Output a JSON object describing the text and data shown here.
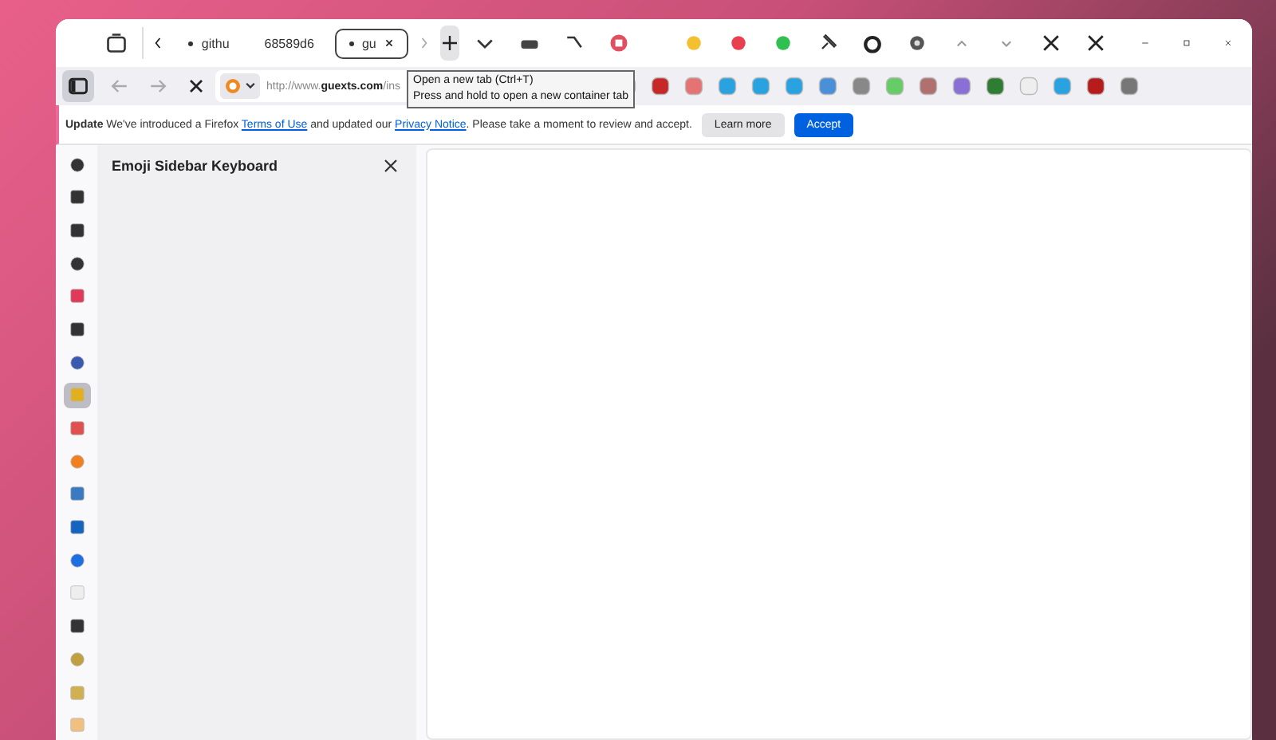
{
  "tabs": [
    {
      "label": "githu",
      "selected": false,
      "closable": false
    },
    {
      "label": "68589d6",
      "selected": false,
      "closable": false
    },
    {
      "label": "gu",
      "selected": true,
      "closable": true
    }
  ],
  "address_bar": {
    "url_host_prefix": "http://www.",
    "url_host": "guexts.com",
    "url_path": "/ins"
  },
  "tooltip": {
    "lines": [
      "Open a new tab (Ctrl+T)",
      "Press and hold to open a new container tab"
    ]
  },
  "notification": {
    "title": "Update",
    "text_before": "We've introduced a Firefox",
    "link_1": "Terms of Use",
    "text_middle": "and updated our",
    "link_2": "Privacy Notice",
    "text_after": ". Please take a moment to review and accept.",
    "buttons": [
      {
        "label": "Learn more",
        "kind": "secondary"
      },
      {
        "label": "Accept",
        "kind": "primary"
      }
    ]
  },
  "sidebar": {
    "title": "Emoji Sidebar Keyboard",
    "items": [
      {
        "selected": false
      },
      {
        "selected": false
      },
      {
        "selected": false
      },
      {
        "selected": false
      },
      {
        "selected": false
      },
      {
        "selected": false
      },
      {
        "selected": false
      },
      {
        "selected": true
      },
      {
        "selected": false
      },
      {
        "selected": false
      },
      {
        "selected": false
      },
      {
        "selected": false
      },
      {
        "selected": false
      },
      {
        "selected": false
      },
      {
        "selected": false
      },
      {
        "selected": false
      },
      {
        "selected": false
      },
      {
        "selected": false
      }
    ]
  }
}
